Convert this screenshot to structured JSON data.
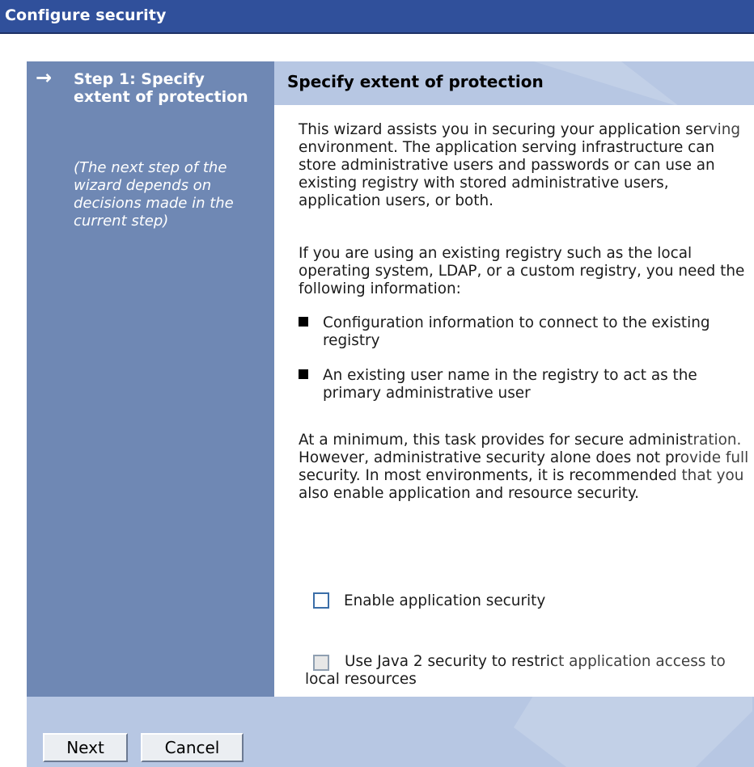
{
  "window": {
    "title": "Configure security"
  },
  "steps": {
    "arrow": "→",
    "current_title": "Step 1: Specify extent of protection",
    "note": "(The next step of the wizard depends on decisions made in the current step)"
  },
  "main": {
    "header": "Specify extent of protection",
    "intro": "This wizard assists you in securing your application serving environment. The application serving infrastructure can store administrative users and passwords or can use an existing registry with stored administrative users, application users, or both.",
    "registry_intro": "If you are using an existing registry such as the local operating system, LDAP, or a custom registry, you need the following information:",
    "bullets": [
      "Configuration information to connect to the existing registry",
      "An existing user name in the registry to act as the primary administrative user"
    ],
    "summary": "At a minimum, this task provides for secure administration. However, administrative security alone does not provide full security. In most environments, it is recommended that you also enable application and resource security."
  },
  "options": {
    "app_security": {
      "label": "Enable application security",
      "checked": false
    },
    "java2_security": {
      "label": "Use Java 2 security to restrict application access to local resources",
      "checked": false,
      "disabled": true
    }
  },
  "buttons": {
    "next": "Next",
    "cancel": "Cancel"
  },
  "colors": {
    "title_bar": "#30509b",
    "step_panel": "#6f88b4",
    "header_band": "#b7c7e3"
  }
}
